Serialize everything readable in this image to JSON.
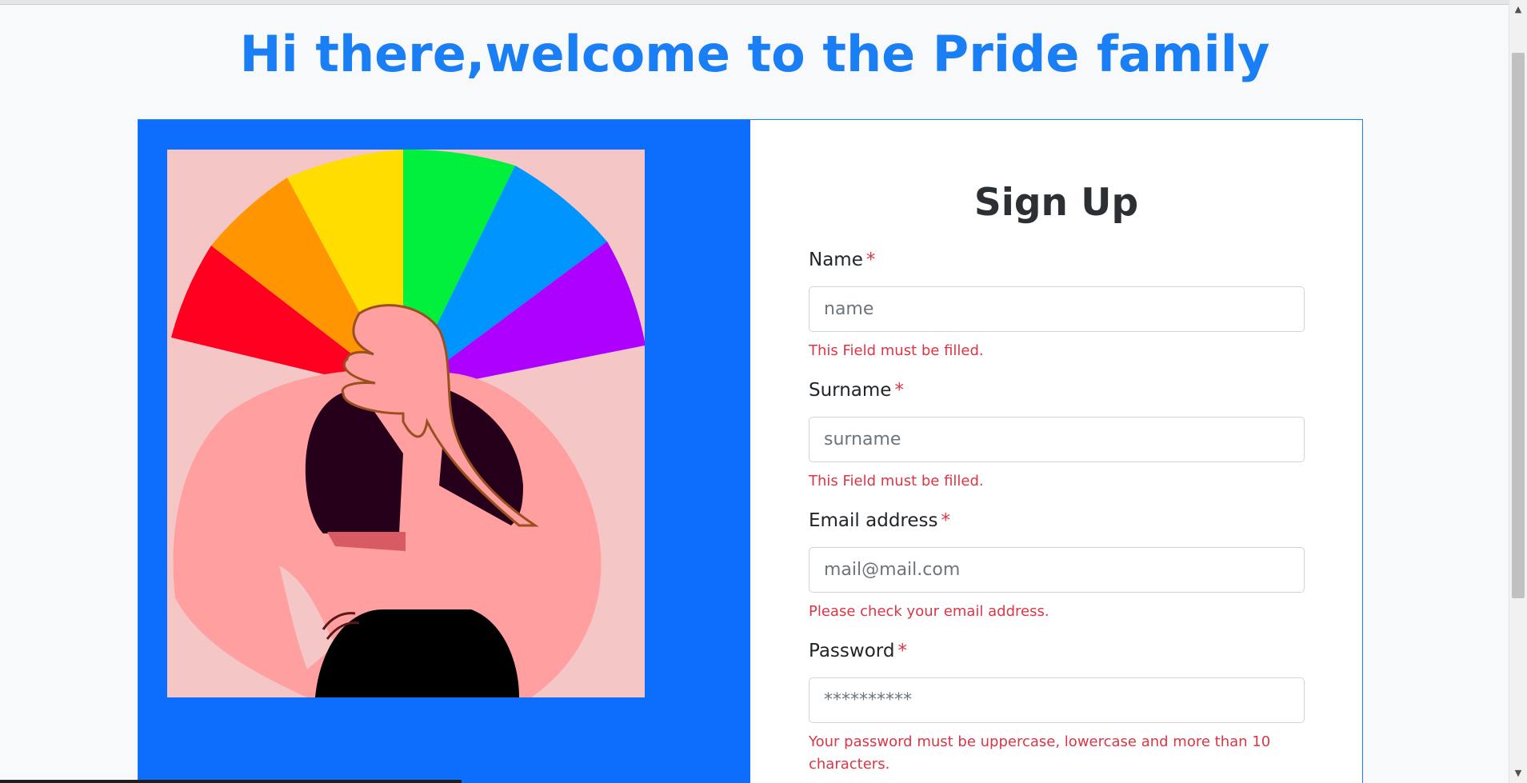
{
  "page": {
    "heading": "Hi there,welcome to the Pride family"
  },
  "form": {
    "title": "Sign Up",
    "required_mark": "*",
    "fields": [
      {
        "label": "Name",
        "placeholder": "name",
        "value": "",
        "error": "This Field must be filled."
      },
      {
        "label": "Surname",
        "placeholder": "surname",
        "value": "",
        "error": "This Field must be filled."
      },
      {
        "label": "Email address",
        "placeholder": "mail@mail.com",
        "value": "",
        "error": "Please check your email address."
      },
      {
        "label": "Password",
        "placeholder": "**********",
        "value": "",
        "error": "Your password must be uppercase, lowercase and more than 10 characters."
      }
    ]
  },
  "colors": {
    "accent": "#1a7ef5",
    "panel_blue": "#0d6efd",
    "error": "#dc3545",
    "page_background": "#f8f9fa"
  },
  "icons": {
    "scroll_up": "scroll-up-arrow-icon",
    "scroll_down": "scroll-down-arrow-icon"
  }
}
